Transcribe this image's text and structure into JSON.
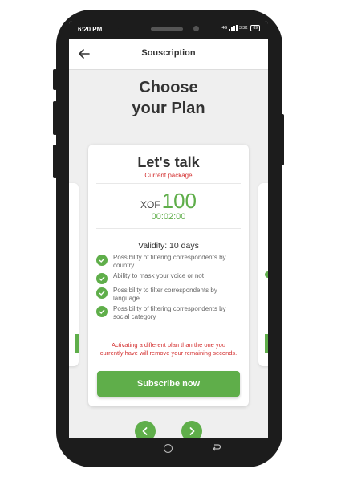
{
  "status_bar": {
    "time": "6:20 PM",
    "network_text": "4G",
    "speed_text": "3.3K",
    "battery": "89"
  },
  "app_bar": {
    "title": "Souscription",
    "back_icon": "arrow-left-icon"
  },
  "page": {
    "title_line1": "Choose",
    "title_line2": "your Plan"
  },
  "plan": {
    "name": "Let's talk",
    "current_label": "Current package",
    "currency": "XOF",
    "amount": "100",
    "duration": "00:02:00",
    "validity": "Validity: 10 days",
    "features": [
      "Possibility of filtering correspondents by country",
      "Ability to mask your voice or not",
      "Possibility to filter correspondents by language",
      "Possibility of filtering correspondents by social category"
    ],
    "warning": "Activating a different plan than the one you currently have will remove your remaining seconds.",
    "subscribe_label": "Subscribe now"
  },
  "colors": {
    "accent": "#5fae4a",
    "warning": "#d32f2f",
    "background": "#efefef"
  },
  "icons": {
    "feature_check": "check-circle-icon",
    "prev": "chevron-left-icon",
    "next": "chevron-right-icon"
  }
}
